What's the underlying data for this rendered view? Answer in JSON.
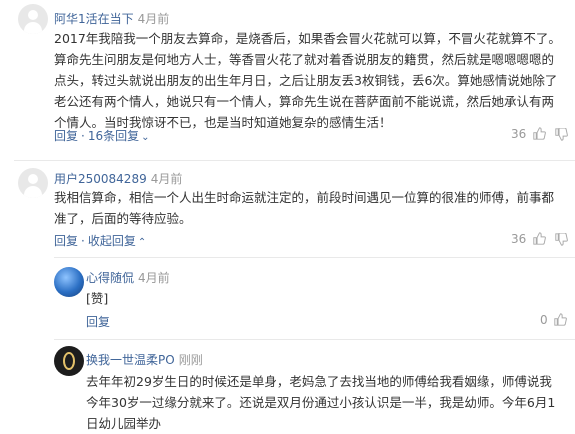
{
  "comments": [
    {
      "user": "阿华1活在当下",
      "time": "4月前",
      "text": "2017年我陪我一个朋友去算命，是烧香后，如果香会冒火花就可以算，不冒火花就算不了。算命先生问朋友是何地方人士，等香冒火花了就对着香说朋友的籍贯，然后就是嗯嗯嗯嗯的点头，转过头就说出朋友的出生年月日，之后让朋友丢3枚铜钱，丢6次。算她感情说她除了老公还有两个情人，她说只有一个情人，算命先生说在菩萨面前不能说谎，然后她承认有两个情人。当时我惊讶不已，也是当时知道她复杂的感情生活！",
      "reply_label": "回复",
      "replies_toggle": "16条回复",
      "likes": "36"
    },
    {
      "user": "用户250084289",
      "time": "4月前",
      "text": "我相信算命，相信一个人出生时命运就注定的，前段时间遇见一位算的很准的师傅，前事都准了，后面的等待应验。",
      "reply_label": "回复",
      "replies_toggle": "收起回复",
      "likes": "36"
    },
    {
      "user": "心得随侃",
      "time": "4月前",
      "text": "[赞]",
      "reply_label": "回复",
      "likes": "0"
    },
    {
      "user": "换我一世温柔PO",
      "time": "刚刚",
      "text": "去年年初29岁生日的时候还是单身，老妈急了去找当地的师傅给我看姻缘，师傅说我今年30岁一过缘分就来了。还说是双月份通过小孩认识是一半，我是幼师。今年6月1日幼儿园举办"
    }
  ],
  "icons": {
    "thumb_up": "thumb-up-icon",
    "thumb_down": "thumb-down-icon",
    "chevron": "chevron-down-icon"
  },
  "colors": {
    "link": "#406599",
    "muted": "#999999",
    "text": "#333333"
  }
}
